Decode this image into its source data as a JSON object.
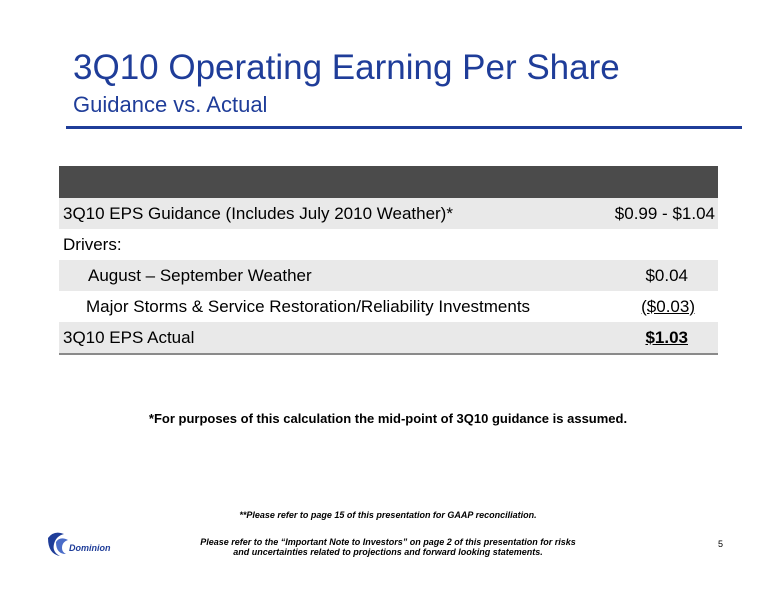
{
  "header": {
    "title": "3Q10 Operating Earning Per Share",
    "subtitle": "Guidance vs. Actual"
  },
  "table": {
    "rows": [
      {
        "label": "3Q10 EPS Guidance (Includes July 2010 Weather)*",
        "value": "$0.99 - $1.04"
      },
      {
        "label": "Drivers:",
        "value": ""
      },
      {
        "label": "August – September Weather",
        "value": "$0.04"
      },
      {
        "label": "Major Storms & Service Restoration/Reliability Investments",
        "value": "($0.03)"
      },
      {
        "label": "3Q10 EPS Actual",
        "value": "$1.03"
      }
    ]
  },
  "footnote": "*For purposes of this calculation the mid-point of 3Q10 guidance is assumed.",
  "gaap_note": "**Please refer to page 15 of this presentation for GAAP reconciliation.",
  "investor_note": {
    "line1": "Please refer to the “Important Note to Investors” on page 2 of this presentation for risks",
    "line2": "and uncertainties related to projections and forward looking statements."
  },
  "logo": {
    "text": "Dominion",
    "icon": "dominion-logo-icon",
    "color": "#1f3d99"
  },
  "page_number": "5"
}
